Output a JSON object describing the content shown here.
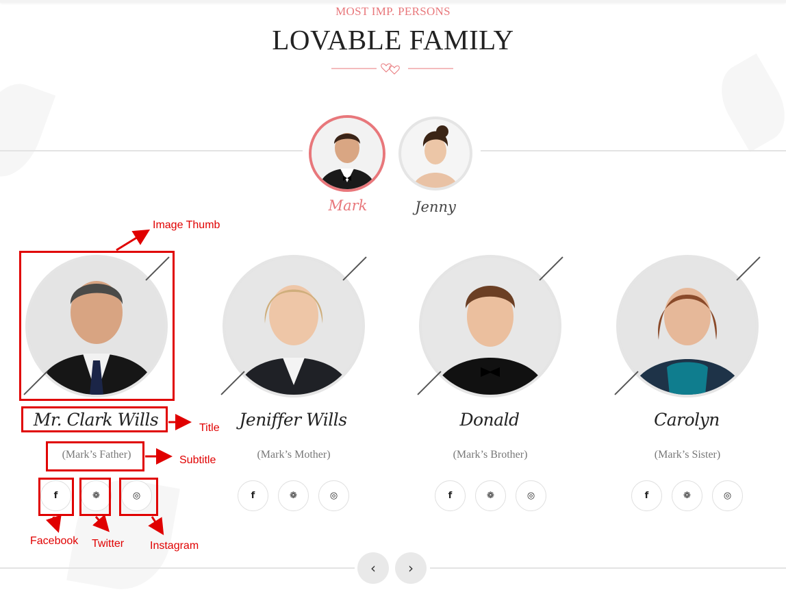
{
  "header": {
    "eyebrow": "MOST IMP. PERSONS",
    "title": "LOVABLE FAMILY"
  },
  "couple_tabs": [
    {
      "name": "Mark",
      "active": true
    },
    {
      "name": "Jenny",
      "active": false
    }
  ],
  "members": [
    {
      "name": "Mr. Clark Wills",
      "relation": "(Mark’s Father)"
    },
    {
      "name": "Jeniffer Wills",
      "relation": "(Mark’s Mother)"
    },
    {
      "name": "Donald",
      "relation": "(Mark’s Brother)"
    },
    {
      "name": "Carolyn",
      "relation": "(Mark’s Sister)"
    }
  ],
  "social_icons": {
    "facebook": "f",
    "twitter": "❁",
    "instagram": "◎"
  },
  "carousel": {
    "prev": "‹",
    "next": "›"
  },
  "annotations": {
    "image_thumb": "Image Thumb",
    "title": "Title",
    "subtitle": "Subtitle",
    "facebook": "Facebook",
    "twitter": "Twitter",
    "instagram": "Instagram"
  },
  "colors": {
    "accent": "#e8777b",
    "annotation": "#e00000",
    "line": "#e3e3e3"
  }
}
